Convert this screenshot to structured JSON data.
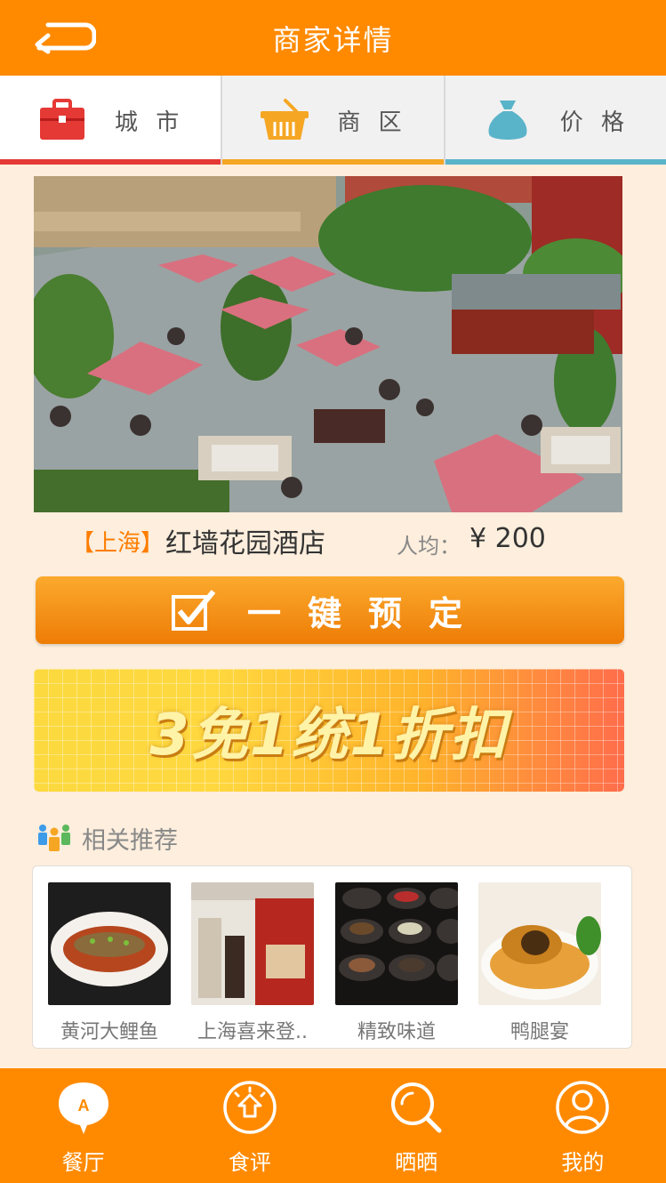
{
  "header": {
    "title": "商家详情",
    "back_icon": "back-arrow-icon"
  },
  "tabs": [
    {
      "label": "城 市",
      "icon": "briefcase-icon",
      "color": "#e53935"
    },
    {
      "label": "商 区",
      "icon": "basket-icon",
      "color": "#f5a623"
    },
    {
      "label": "价 格",
      "icon": "money-bag-icon",
      "color": "#5ab4c9"
    }
  ],
  "merchant": {
    "city": "【上海】",
    "name": "红墙花园酒店",
    "avg_label": "人均：",
    "price": "¥ 200"
  },
  "book_button": {
    "label": "一键预定",
    "icon": "checkbox-icon"
  },
  "promo": {
    "text": "3免1统1折扣"
  },
  "related": {
    "title": "相关推荐",
    "items": [
      {
        "name": "黄河大鲤鱼"
      },
      {
        "name": "上海喜来登.."
      },
      {
        "name": "精致味道"
      },
      {
        "name": "鸭腿宴"
      }
    ]
  },
  "bottom_nav": [
    {
      "label": "餐厅",
      "icon": "restaurant-bubble-icon"
    },
    {
      "label": "食评",
      "icon": "review-icon"
    },
    {
      "label": "晒晒",
      "icon": "search-icon"
    },
    {
      "label": "我的",
      "icon": "user-icon"
    }
  ],
  "colors": {
    "accent": "#ff8a00",
    "background": "#fdeedd"
  }
}
